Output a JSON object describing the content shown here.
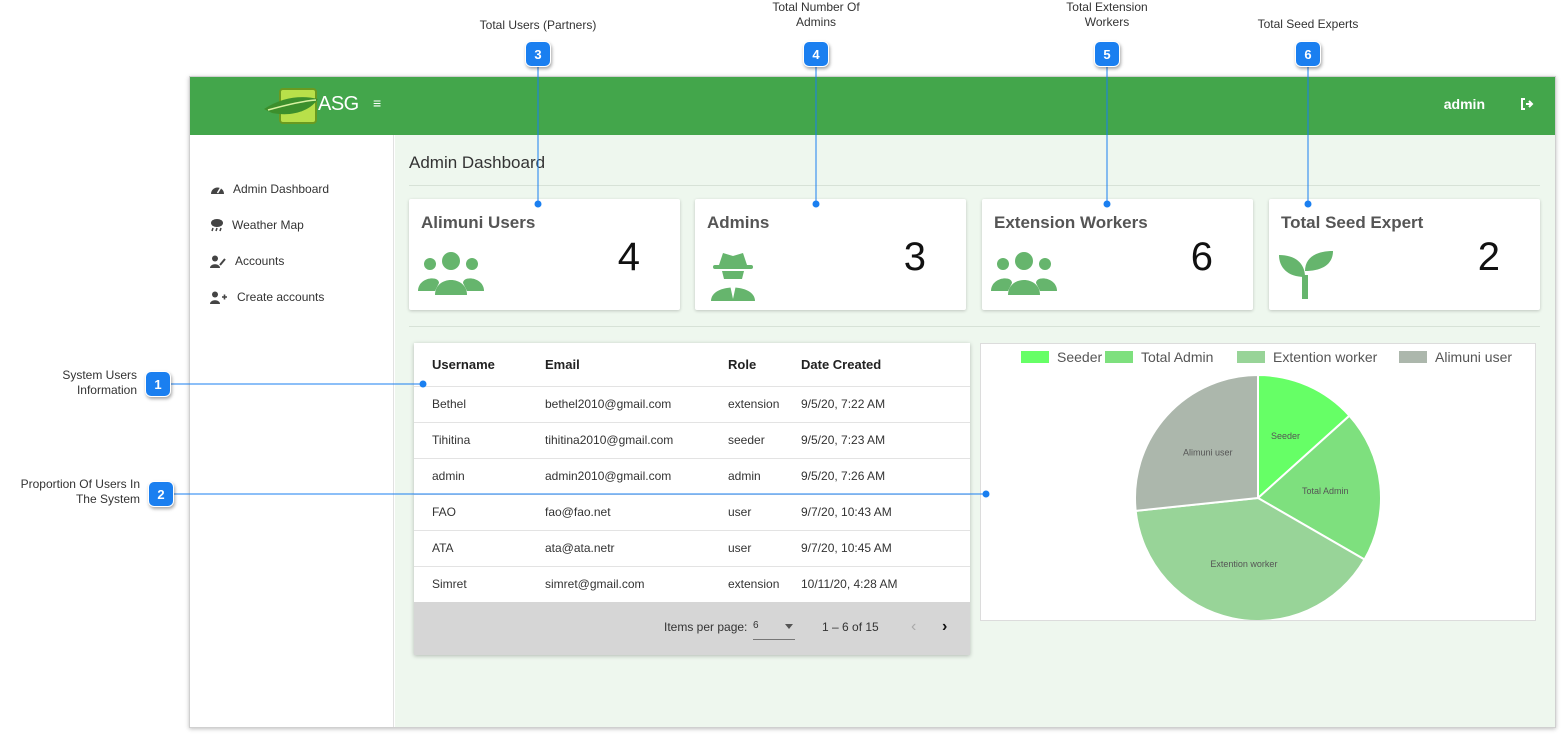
{
  "callouts": [
    {
      "number": "1",
      "label": "System Users Information"
    },
    {
      "number": "2",
      "label": "Proportion Of Users In The System"
    },
    {
      "number": "3",
      "label": "Total Users (Partners)"
    },
    {
      "number": "4",
      "label": "Total Number Of Admins"
    },
    {
      "number": "5",
      "label": "Total Extension Workers"
    },
    {
      "number": "6",
      "label": "Total Seed Experts"
    }
  ],
  "header": {
    "logo_text": "ASG",
    "menu_icon": "≡",
    "user_name": "admin"
  },
  "sidebar": {
    "items": [
      {
        "label": "Admin Dashboard",
        "icon": "tachometer-icon"
      },
      {
        "label": "Weather Map",
        "icon": "cloud-rain-icon"
      },
      {
        "label": "Accounts",
        "icon": "user-edit-icon"
      },
      {
        "label": "Create accounts",
        "icon": "user-plus-icon"
      }
    ]
  },
  "main": {
    "title": "Admin Dashboard",
    "cards": [
      {
        "title": "Alimuni Users",
        "count": "4",
        "icon": "users-icon"
      },
      {
        "title": "Admins",
        "count": "3",
        "icon": "user-secret-icon"
      },
      {
        "title": "Extension Workers",
        "count": "6",
        "icon": "users-icon"
      },
      {
        "title": "Total Seed Expert",
        "count": "2",
        "icon": "seedling-icon"
      }
    ]
  },
  "table": {
    "headers": [
      "Username",
      "Email",
      "Role",
      "Date Created"
    ],
    "rows": [
      [
        "Bethel",
        "bethel2010@gmail.com",
        "extension",
        "9/5/20, 7:22 AM"
      ],
      [
        "Tihitina",
        "tihitina2010@gmail.com",
        "seeder",
        "9/5/20, 7:23 AM"
      ],
      [
        "admin",
        "admin2010@gmail.com",
        "admin",
        "9/5/20, 7:26 AM"
      ],
      [
        "FAO",
        "fao@fao.net",
        "user",
        "9/7/20, 10:43 AM"
      ],
      [
        "ATA",
        "ata@ata.netr",
        "user",
        "9/7/20, 10:45 AM"
      ],
      [
        "Simret",
        "simret@gmail.com",
        "extension",
        "10/11/20, 4:28 AM"
      ]
    ],
    "paginator": {
      "items_per_page_label": "Items per page:",
      "page_size": "6",
      "range": "1 – 6 of 15",
      "prev": "‹",
      "next": "›"
    }
  },
  "colors": {
    "header_green": "#43a64b",
    "icon_green": "#66b56d",
    "callout_blue": "#1a7ff0"
  },
  "chart_data": {
    "type": "pie",
    "categories": [
      "Seeder",
      "Total Admin",
      "Extention worker",
      "Alimuni user"
    ],
    "values": [
      2,
      3,
      6,
      4
    ],
    "colors": [
      "#66ff66",
      "#7ee07e",
      "#98d498",
      "#acb7ac"
    ],
    "legend_position": "top"
  }
}
